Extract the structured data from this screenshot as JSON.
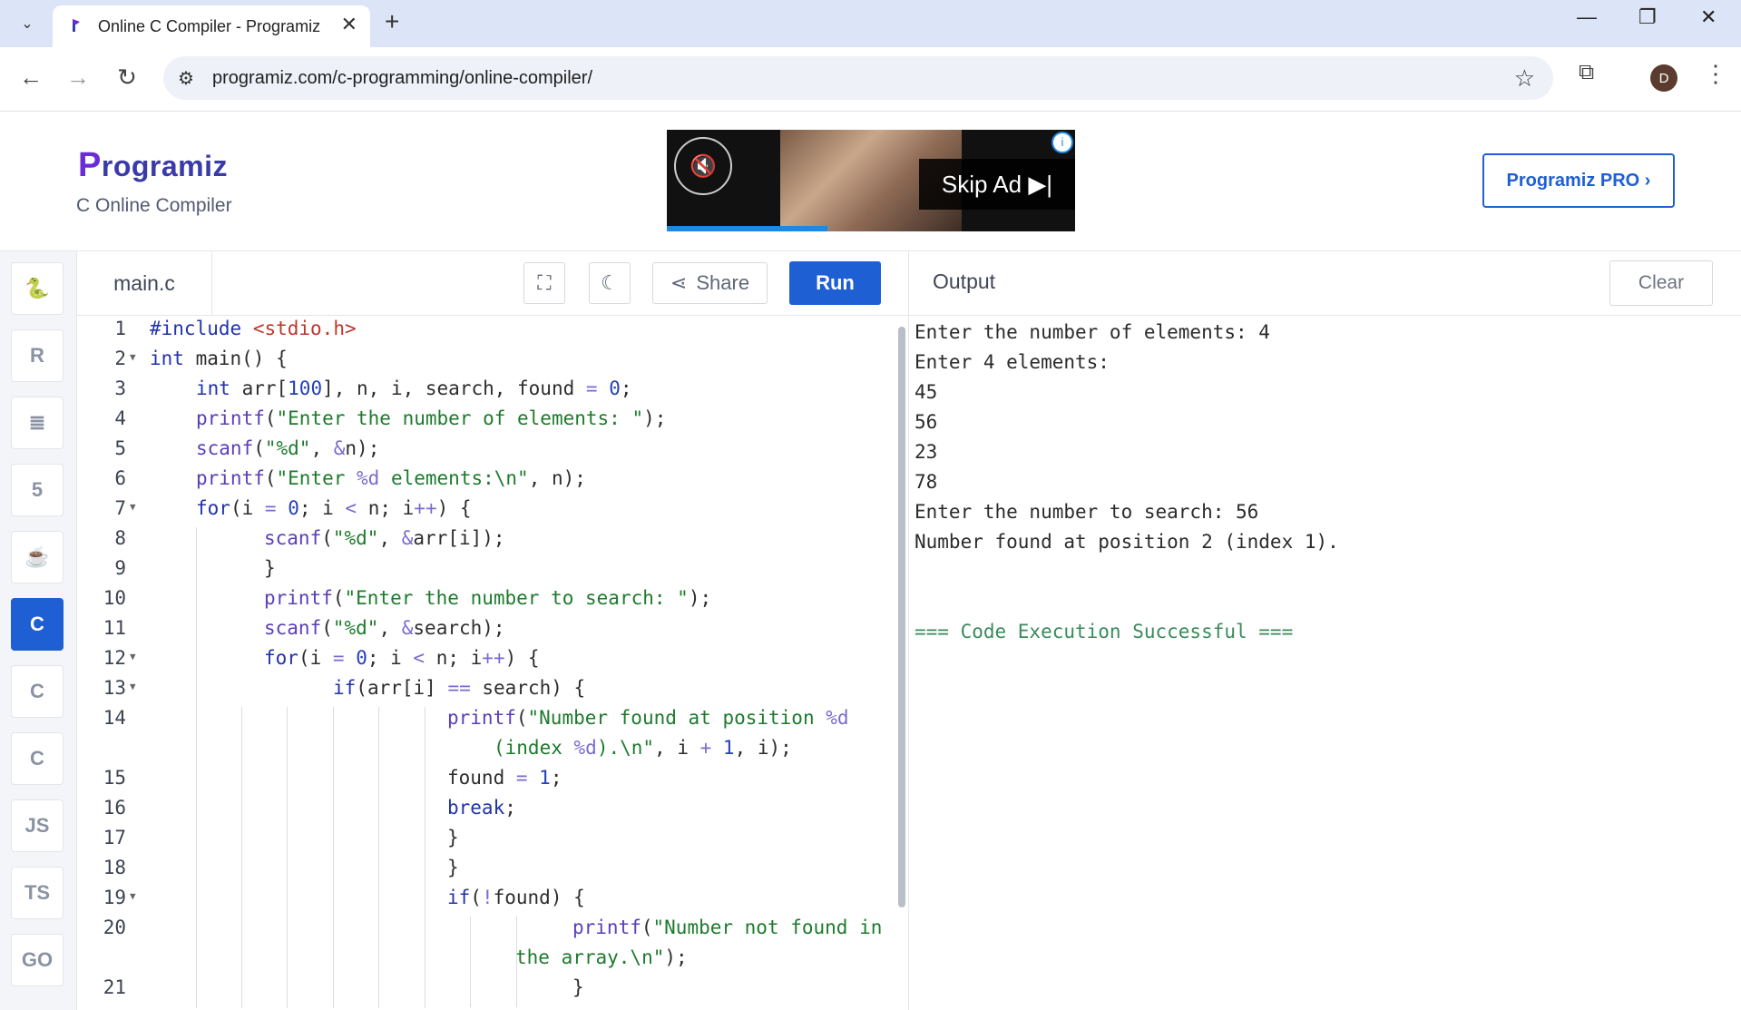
{
  "browser": {
    "tab_title": "Online C Compiler - Programiz",
    "url": "programiz.com/c-programming/online-compiler/",
    "avatar_letter": "D"
  },
  "header": {
    "logo_first": "P",
    "logo_rest": "rogramiz",
    "subtitle": "C Online Compiler",
    "ad_skip": "Skip Ad ▶|",
    "pro_button": "Programiz PRO ›"
  },
  "sidebar": {
    "items": [
      {
        "name": "python",
        "label": "🐍"
      },
      {
        "name": "r",
        "label": "R"
      },
      {
        "name": "sql",
        "label": "≣"
      },
      {
        "name": "html",
        "label": "5"
      },
      {
        "name": "java",
        "label": "☕"
      },
      {
        "name": "c",
        "label": "C"
      },
      {
        "name": "cpp",
        "label": "C"
      },
      {
        "name": "csharp",
        "label": "C"
      },
      {
        "name": "js",
        "label": "JS"
      },
      {
        "name": "ts",
        "label": "TS"
      },
      {
        "name": "go",
        "label": "GO"
      }
    ]
  },
  "editor": {
    "filename": "main.c",
    "share_label": "Share",
    "run_label": "Run"
  },
  "output": {
    "title": "Output",
    "clear_label": "Clear",
    "lines": [
      "Enter the number of elements: 4",
      "Enter 4 elements:",
      "45",
      "56",
      "23",
      "78",
      "Enter the number to search: 56",
      "Number found at position 2 (index 1).",
      "",
      "",
      "=== Code Execution Successful ==="
    ]
  },
  "code_lines": [
    "1",
    "2",
    "3",
    "4",
    "5",
    "6",
    "7",
    "8",
    "9",
    "10",
    "11",
    "12",
    "13",
    "14",
    "",
    "15",
    "16",
    "17",
    "18",
    "19",
    "20",
    "",
    "21"
  ]
}
